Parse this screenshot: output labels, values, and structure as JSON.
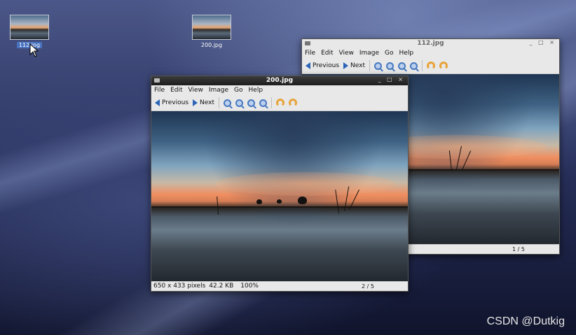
{
  "desktop": {
    "icons": [
      {
        "label": "112.jpg",
        "selected": true
      },
      {
        "label": "200.jpg",
        "selected": false
      }
    ]
  },
  "windows": {
    "back": {
      "title": "112.jpg",
      "menu": [
        "File",
        "Edit",
        "View",
        "Image",
        "Go",
        "Help"
      ],
      "toolbar": {
        "previous": "Previous",
        "next": "Next"
      },
      "status": {
        "position": "1 / 5"
      }
    },
    "front": {
      "title": "200.jpg",
      "menu": [
        "File",
        "Edit",
        "View",
        "Image",
        "Go",
        "Help"
      ],
      "toolbar": {
        "previous": "Previous",
        "next": "Next"
      },
      "status": {
        "dimensions": "650 x 433 pixels",
        "size": "42.2 KB",
        "zoom": "100%",
        "position": "2 / 5"
      }
    }
  },
  "window_controls": "_ □ ×",
  "watermark": "CSDN @Dutkig",
  "colors": {
    "accent": "#2c65b8",
    "rotate": "#e8a33a",
    "selection": "#4a73c0"
  }
}
